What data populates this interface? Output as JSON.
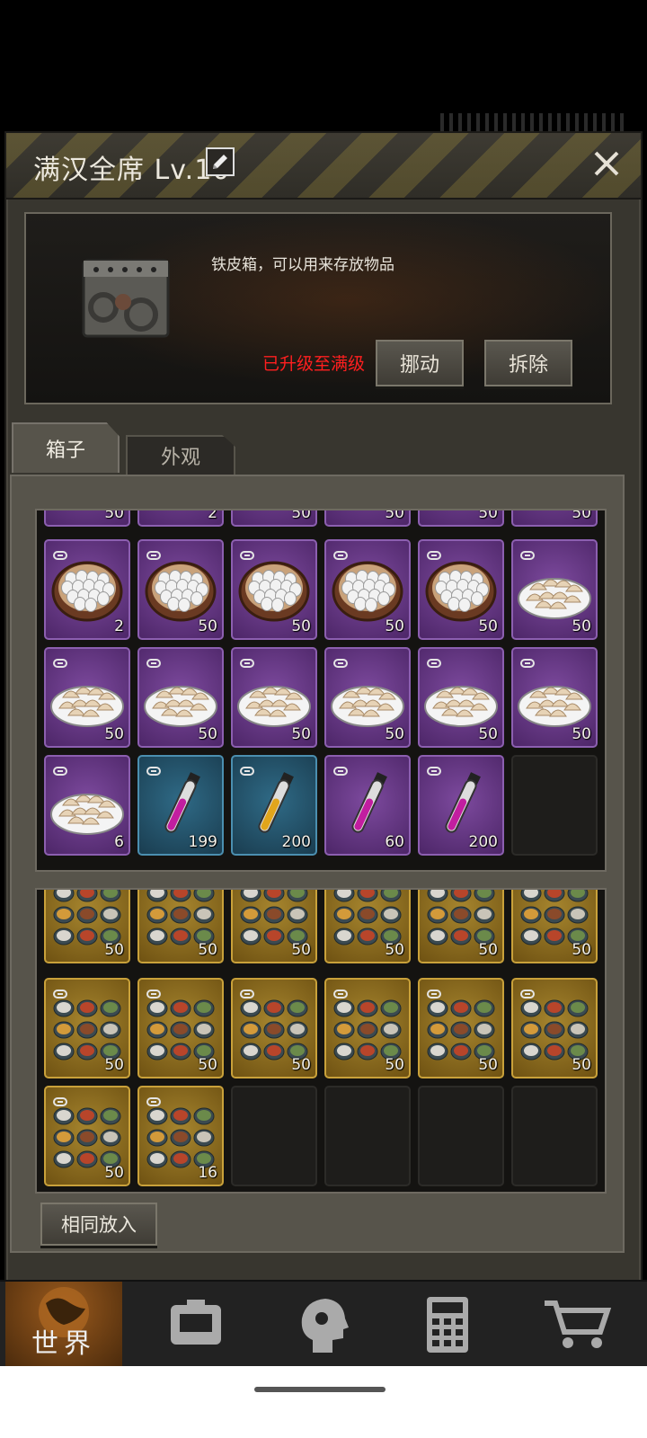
{
  "header": {
    "title": "满汉全席 Lv.10"
  },
  "info": {
    "description": "铁皮箱，可以用来存放物品",
    "status": "已升级至满级",
    "move_label": "挪动",
    "remove_label": "拆除"
  },
  "tabs": [
    {
      "label": "箱子"
    },
    {
      "label": "外观"
    }
  ],
  "grid1": {
    "rows": [
      {
        "cells": [
          {
            "type": "partial",
            "qty": "50"
          },
          {
            "type": "partial",
            "qty": "2"
          },
          {
            "type": "partial",
            "qty": "50"
          },
          {
            "type": "partial",
            "qty": "50"
          },
          {
            "type": "partial",
            "qty": "50"
          },
          {
            "type": "partial",
            "qty": "50"
          }
        ]
      },
      {
        "cells": [
          {
            "item": "egg-bowl",
            "qty": "2"
          },
          {
            "item": "egg-bowl",
            "qty": "50"
          },
          {
            "item": "egg-bowl",
            "qty": "50"
          },
          {
            "item": "egg-bowl",
            "qty": "50"
          },
          {
            "item": "egg-bowl",
            "qty": "50"
          },
          {
            "item": "dumpling-plate",
            "qty": "50"
          }
        ]
      },
      {
        "cells": [
          {
            "item": "dumpling-plate",
            "qty": "50"
          },
          {
            "item": "dumpling-plate",
            "qty": "50"
          },
          {
            "item": "dumpling-plate",
            "qty": "50"
          },
          {
            "item": "dumpling-plate",
            "qty": "50"
          },
          {
            "item": "dumpling-plate",
            "qty": "50"
          },
          {
            "item": "dumpling-plate",
            "qty": "50"
          }
        ]
      },
      {
        "cells": [
          {
            "item": "dumpling-plate",
            "qty": "6"
          },
          {
            "item": "magenta-potion",
            "qty": "199"
          },
          {
            "item": "yellow-potion",
            "qty": "200"
          },
          {
            "item": "magenta-potion",
            "qty": "60"
          },
          {
            "item": "magenta-potion",
            "qty": "200"
          },
          {
            "item": "empty",
            "qty": ""
          }
        ]
      }
    ]
  },
  "grid2": {
    "rows": [
      {
        "cells": [
          {
            "item": "feast",
            "qty": "50"
          },
          {
            "item": "feast",
            "qty": "50"
          },
          {
            "item": "feast",
            "qty": "50"
          },
          {
            "item": "feast",
            "qty": "50"
          },
          {
            "item": "feast",
            "qty": "50"
          },
          {
            "item": "feast",
            "qty": "50"
          }
        ]
      },
      {
        "cells": [
          {
            "item": "feast",
            "qty": "50"
          },
          {
            "item": "feast",
            "qty": "50"
          },
          {
            "item": "feast",
            "qty": "50"
          },
          {
            "item": "feast",
            "qty": "50"
          },
          {
            "item": "feast",
            "qty": "50"
          },
          {
            "item": "feast",
            "qty": "50"
          }
        ]
      },
      {
        "cells": [
          {
            "item": "feast",
            "qty": "50"
          },
          {
            "item": "feast",
            "qty": "16"
          },
          {
            "item": "empty",
            "qty": ""
          },
          {
            "item": "empty",
            "qty": ""
          },
          {
            "item": "empty",
            "qty": ""
          },
          {
            "item": "empty",
            "qty": ""
          }
        ]
      }
    ]
  },
  "same_put_label": "相同放入",
  "nav": {
    "world_label": "世界",
    "items": [
      "world-icon",
      "backpack-icon",
      "head-icon",
      "calculator-icon",
      "cart-icon"
    ]
  },
  "colors": {
    "purple_rarity": "#7d4a9e",
    "blue_rarity": "#2f6a86",
    "gold_rarity": "#a6852e",
    "status_red": "#ff1f1f"
  }
}
